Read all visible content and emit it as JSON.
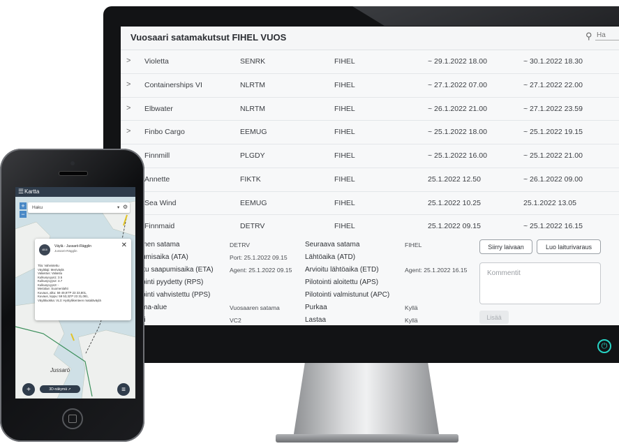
{
  "app": {
    "title": "Vuosaari satamakutsut FIHEL VUOS",
    "search_placeholder": "Ha"
  },
  "vessels": [
    {
      "name": "Violetta",
      "lo": "SENRK",
      "dest": "FIHEL",
      "eta": "~ 29.1.2022 18.00",
      "etd": "~ 30.1.2022 18.30",
      "expander": ">"
    },
    {
      "name": "Containerships VI",
      "lo": "NLRTM",
      "dest": "FIHEL",
      "eta": "~ 27.1.2022 07.00",
      "etd": "~ 27.1.2022 22.00",
      "expander": ">"
    },
    {
      "name": "Elbwater",
      "lo": "NLRTM",
      "dest": "FIHEL",
      "eta": "~ 26.1.2022 21.00",
      "etd": "~ 27.1.2022 23.59",
      "expander": ">"
    },
    {
      "name": "Finbo Cargo",
      "lo": "EEMUG",
      "dest": "FIHEL",
      "eta": "~ 25.1.2022 18.00",
      "etd": "~ 25.1.2022 19.15",
      "expander": ">"
    },
    {
      "name": "Finnmill",
      "lo": "PLGDY",
      "dest": "FIHEL",
      "eta": "~ 25.1.2022 16.00",
      "etd": "~ 25.1.2022 21.00",
      "expander": ""
    },
    {
      "name": "Annette",
      "lo": "FIKTK",
      "dest": "FIHEL",
      "eta": "25.1.2022 12.50",
      "etd": "~ 26.1.2022 09.00",
      "expander": ""
    },
    {
      "name": "Sea Wind",
      "lo": "EEMUG",
      "dest": "FIHEL",
      "eta": "25.1.2022 10.25",
      "etd": "25.1.2022 13.05",
      "expander": ""
    },
    {
      "name": "Finnmaid",
      "lo": "DETRV",
      "dest": "FIHEL",
      "eta": "25.1.2022 09.15",
      "etd": "~ 25.1.2022 16.15",
      "expander": ""
    }
  ],
  "detail": {
    "left_labels": [
      "inen satama",
      "umisaika (ATA)",
      "itu saapumisaika (ETA)",
      "pinti pyydetty (RPS)",
      "pinti vahvistettu (PPS)",
      "ma-alue",
      "ri"
    ],
    "left_values": [
      "DETRV",
      "Port: 25.1.2022 09.15",
      "Agent: 25.1.2022 09.15",
      "",
      "",
      "Vuosaaren satama",
      "VC2"
    ],
    "right_labels": [
      "Seuraava satama",
      "Lähtöaika (ATD)",
      "Arvioitu lähtöaika (ETD)",
      "Pilotointi aloitettu (APS)",
      "Pilotointi valmistunut (APC)",
      "Purkaa",
      "Lastaa"
    ],
    "right_values": [
      "FIHEL",
      "",
      "Agent: 25.1.2022 16.15",
      "",
      "",
      "Kyllä",
      "Kyllä"
    ],
    "btn_ship": "Siirry laivaan",
    "btn_berth": "Luo laiturivaraus",
    "comment_placeholder": "Kommentit",
    "add_label": "Lisää"
  },
  "phone": {
    "menu_icon": "☰",
    "title": "Kartta",
    "search_placeholder": "Haku",
    "zoom_in": "+",
    "zoom_out": "−",
    "popup": {
      "badge": "4815",
      "title": "Väylä - Jussarö-Rägglin",
      "subtitle": "Jussarö-Rägglin",
      "close": "✕",
      "lines": [
        "Tila: Vahvistettu",
        "Väylälaji: Meriväylä",
        "Valaistus: Valaistu",
        "Kulkusyvyys1: 3.5",
        "Kulkusyvyys2: 3.7",
        "Kulkusyvyys3: -",
        "Merialue: Suomenlahti",
        "Kuvaus, alku: 59 49,97'P 23 33,801,",
        "Kuvaus, loppu: 59 53,32'P 23 31,081,",
        "Väyläluokka: VL3: Hyötyliikenteen mataläväylä"
      ]
    },
    "island_label": "Jussarö",
    "view_3d": "3D-näkymä",
    "add_fab": "+",
    "layers_fab": "≡"
  },
  "colors": {
    "accent": "#27d3c4",
    "phone_bar": "#2f3c4b",
    "map_land": "#eef0ee",
    "map_water": "#cfe0e6"
  }
}
